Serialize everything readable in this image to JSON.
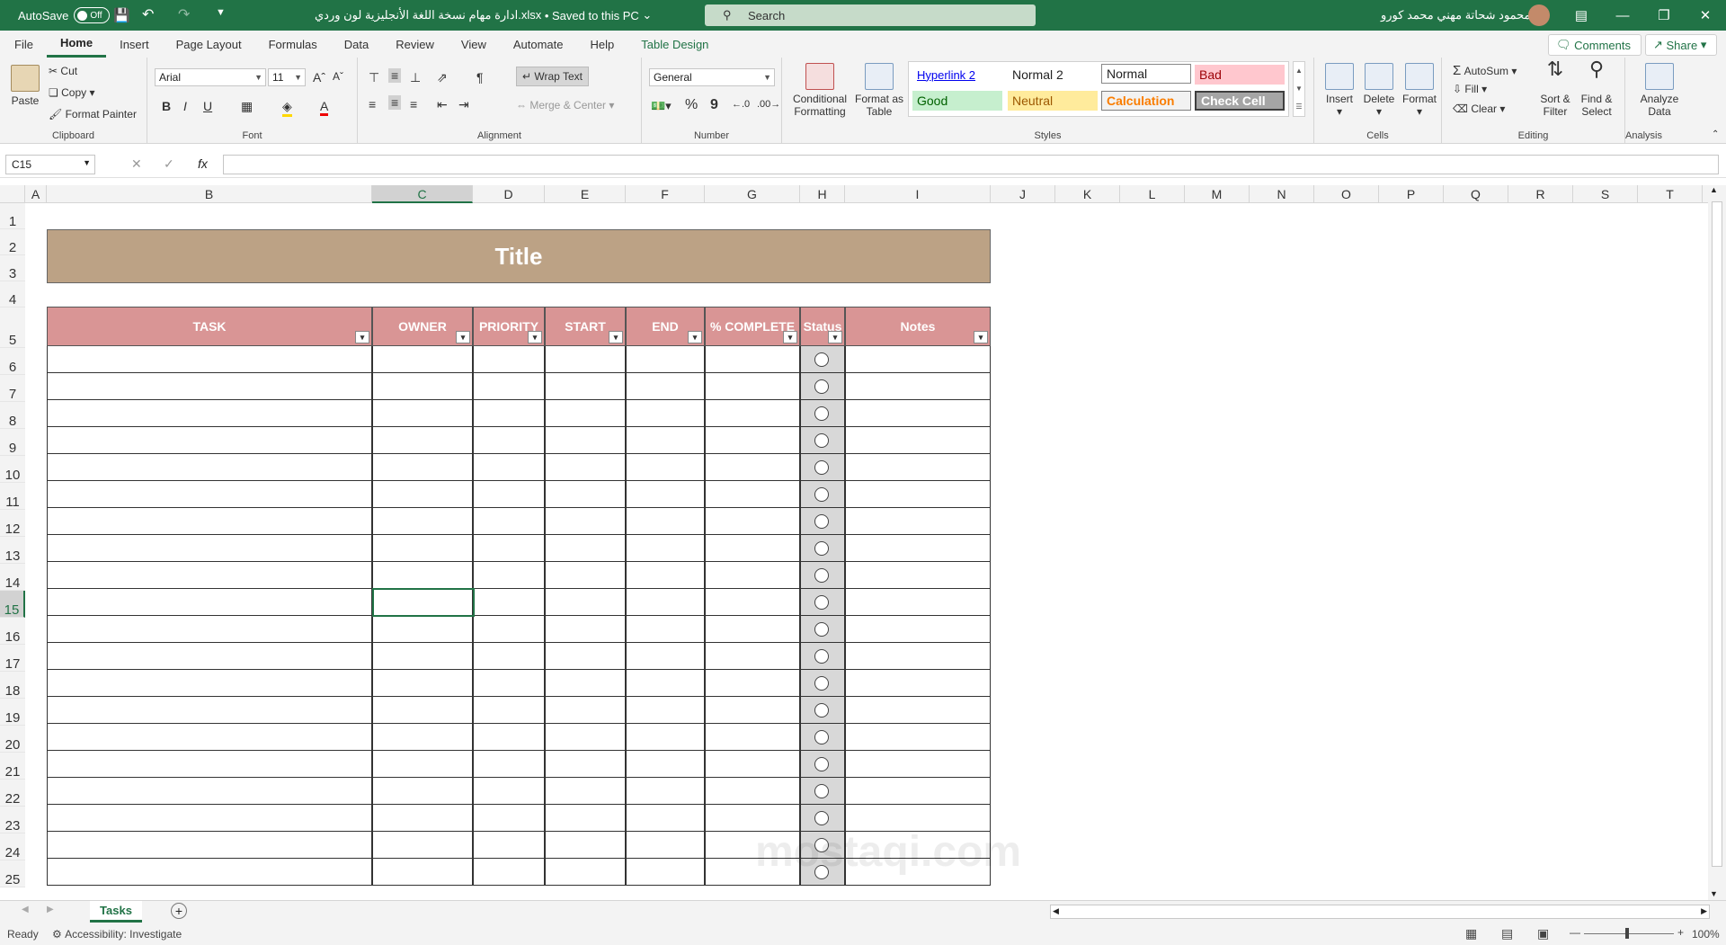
{
  "titlebar": {
    "autosave_label": "AutoSave",
    "autosave_state": "Off",
    "filename": "ادارة مهام نسخة اللغة الأنجليزية لون وردي.xlsx",
    "save_status": "Saved to this PC",
    "search_placeholder": "Search",
    "user_name": "محمود شحاتة مهني محمد كورو"
  },
  "menu": {
    "tabs": [
      "File",
      "Home",
      "Insert",
      "Page Layout",
      "Formulas",
      "Data",
      "Review",
      "View",
      "Automate",
      "Help",
      "Table Design"
    ],
    "comments": "Comments",
    "share": "Share"
  },
  "ribbon": {
    "clipboard": {
      "paste": "Paste",
      "cut": "Cut",
      "copy": "Copy",
      "format_painter": "Format Painter",
      "label": "Clipboard"
    },
    "font": {
      "name": "Arial",
      "size": "11",
      "bold": "B",
      "italic": "I",
      "underline": "U",
      "label": "Font"
    },
    "alignment": {
      "wrap_text": "Wrap Text",
      "merge_center": "Merge & Center",
      "label": "Alignment"
    },
    "number": {
      "format": "General",
      "percent": "%",
      "comma": "9",
      "label": "Number"
    },
    "styles": {
      "conditional": "Conditional Formatting",
      "format_table": "Format as Table",
      "cells": [
        "Hyperlink 2",
        "Normal 2",
        "Normal",
        "Bad",
        "Good",
        "Neutral",
        "Calculation",
        "Check Cell"
      ],
      "label": "Styles"
    },
    "cells": {
      "insert": "Insert",
      "delete": "Delete",
      "format": "Format",
      "label": "Cells"
    },
    "editing": {
      "autosum": "AutoSum",
      "fill": "Fill",
      "clear": "Clear",
      "sort_filter": "Sort & Filter",
      "find_select": "Find & Select",
      "label": "Editing"
    },
    "analysis": {
      "analyze": "Analyze Data",
      "label": "Analysis"
    }
  },
  "formula_bar": {
    "name_box": "C15",
    "fx": "fx",
    "content": ""
  },
  "columns": [
    "A",
    "B",
    "C",
    "D",
    "E",
    "F",
    "G",
    "H",
    "I",
    "J",
    "K",
    "L",
    "M",
    "N",
    "O",
    "P",
    "Q",
    "R",
    "S",
    "T"
  ],
  "rows": [
    "1",
    "2",
    "3",
    "4",
    "5",
    "6",
    "7",
    "8",
    "9",
    "10",
    "11",
    "12",
    "13",
    "14",
    "15",
    "16",
    "17",
    "18",
    "19",
    "20",
    "21",
    "22",
    "23",
    "24",
    "25"
  ],
  "sheet": {
    "title": "Title",
    "headers": [
      "TASK",
      "OWNER",
      "PRIORITY",
      "START",
      "END",
      "% COMPLETE",
      "Status",
      "Notes"
    ]
  },
  "tabs": {
    "active": "Tasks"
  },
  "status": {
    "ready": "Ready",
    "accessibility": "Accessibility: Investigate",
    "zoom": "100%"
  },
  "watermark": "mostaqi.com"
}
